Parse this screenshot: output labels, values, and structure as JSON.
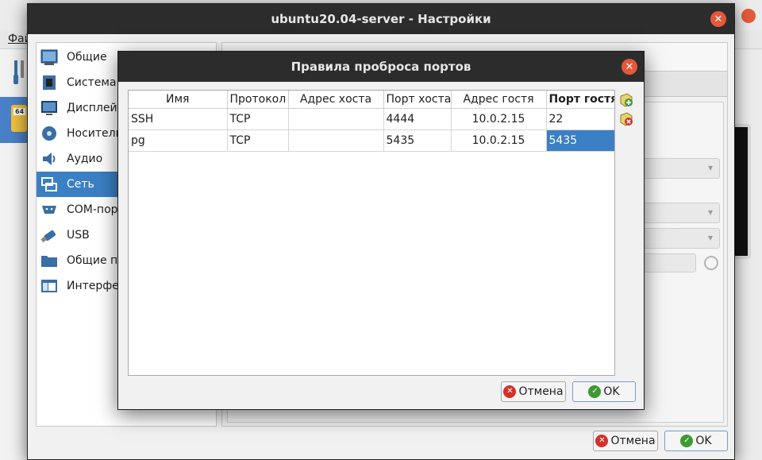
{
  "background": {
    "menu_file_label": "Фай",
    "vm_badge": "64"
  },
  "settings": {
    "title": "ubuntu20.04-server - Настройки",
    "sidebar": {
      "items": [
        {
          "label": "Общие",
          "icon": "general-icon"
        },
        {
          "label": "Система",
          "icon": "chip-icon"
        },
        {
          "label": "Дисплей",
          "icon": "monitor-icon"
        },
        {
          "label": "Носители",
          "icon": "disk-icon"
        },
        {
          "label": "Аудио",
          "icon": "speaker-icon"
        },
        {
          "label": "Сеть",
          "icon": "network-icon",
          "selected": true
        },
        {
          "label": "COM-порт",
          "icon": "serial-port-icon"
        },
        {
          "label": "USB",
          "icon": "usb-icon"
        },
        {
          "label": "Общие па",
          "icon": "shared-folder-icon"
        },
        {
          "label": "Интерфей",
          "icon": "interface-icon"
        }
      ]
    },
    "footer": {
      "cancel_label": "Отмена",
      "ok_label": "OK"
    }
  },
  "dialog": {
    "title": "Правила проброса портов",
    "columns": [
      "Имя",
      "Протокол",
      "Адрес хоста",
      "Порт хоста",
      "Адрес гостя",
      "Порт гостя"
    ],
    "sorted_column": "Порт гостя",
    "rows": [
      {
        "name": "SSH",
        "protocol": "TCP",
        "host_ip": "",
        "host_port": "4444",
        "guest_ip": "10.0.2.15",
        "guest_port": "22"
      },
      {
        "name": "pg",
        "protocol": "TCP",
        "host_ip": "",
        "host_port": "5435",
        "guest_ip": "10.0.2.15",
        "guest_port": "5435"
      }
    ],
    "selected_cell": {
      "row": 1,
      "column": "guest_port"
    },
    "cancel_label": "Отмена",
    "ok_label": "OK",
    "colors": {
      "selection": "#3b7fc4",
      "add_green": "#3c9a32",
      "remove_red": "#d2322b"
    }
  }
}
